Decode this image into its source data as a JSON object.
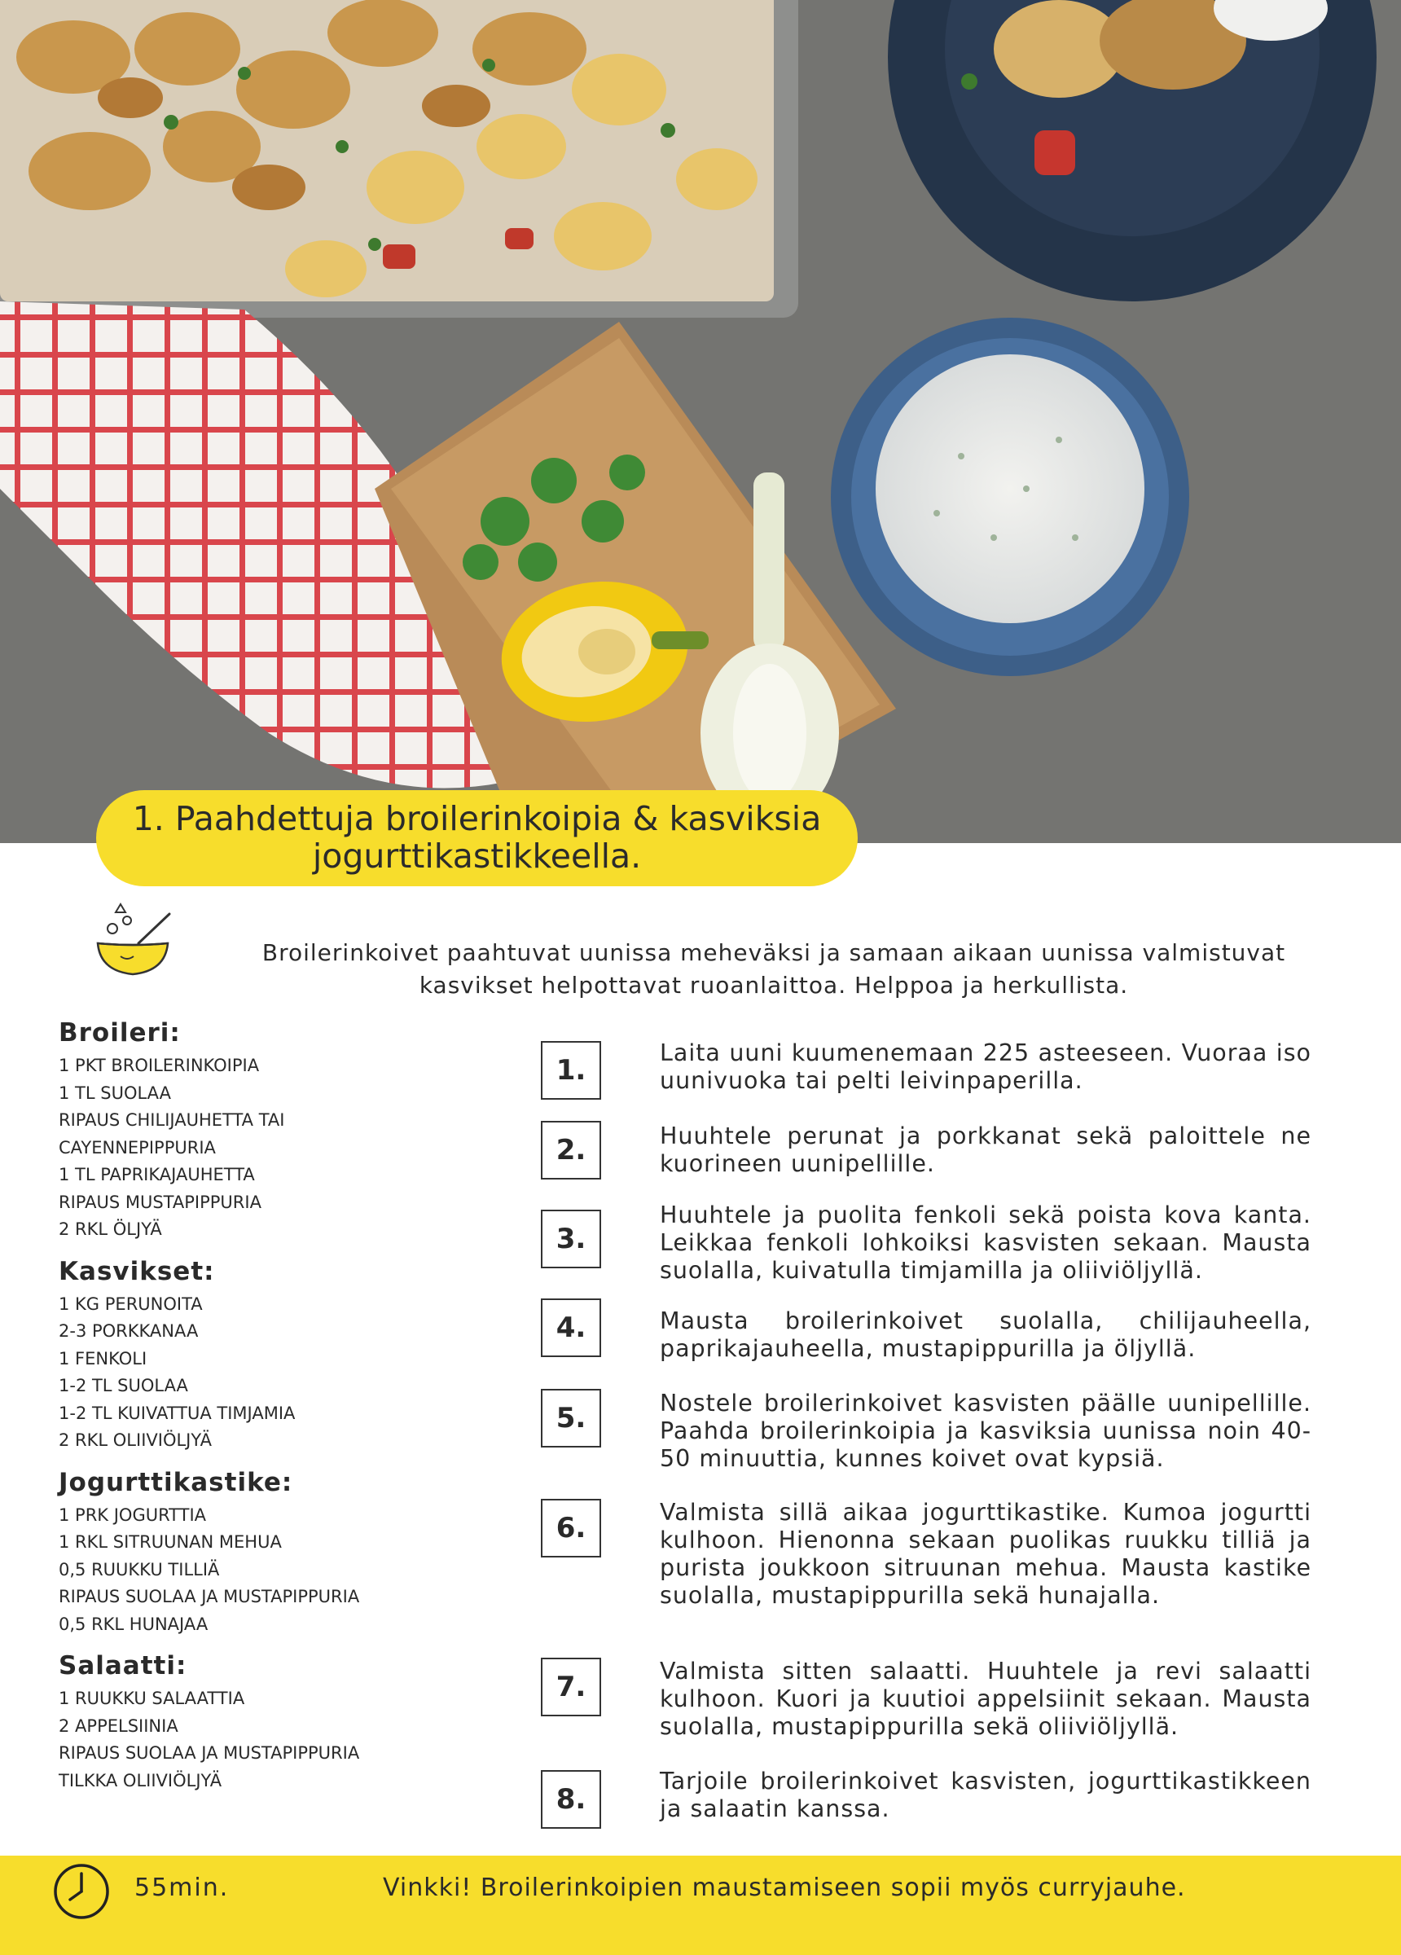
{
  "title": {
    "line1": "1. Paahdettuja broilerinkoipia & kasviksia",
    "line2": "jogurttikastikkeella."
  },
  "intro": "Broilerinkoivet paahtuvat uunissa meheväksi ja samaan aikaan uunissa valmistuvat kasvikset helpottavat ruoanlaittoa. Helppoa ja herkullista.",
  "ingredients": [
    {
      "heading": "Broileri:",
      "items": [
        "1 PKT BROILERINKOIPIA",
        "1 TL SUOLAA",
        "RIPAUS CHILIJAUHETTA TAI",
        "CAYENNEPIPPURIA",
        "1 TL PAPRIKAJAUHETTA",
        "RIPAUS MUSTAPIPPURIA",
        "2 RKL ÖLJYÄ"
      ]
    },
    {
      "heading": "Kasvikset:",
      "items": [
        "1 KG PERUNOITA",
        "2-3 PORKKANAA",
        "1 FENKOLI",
        "1-2 TL SUOLAA",
        "1-2 TL KUIVATTUA TIMJAMIA",
        "2 RKL OLIIVIÖLJYÄ"
      ]
    },
    {
      "heading": "Jogurttikastike:",
      "items": [
        "1 PRK JOGURTTIA",
        "1 RKL SITRUUNAN MEHUA",
        "0,5 RUUKKU TILLIÄ",
        "RIPAUS SUOLAA JA MUSTAPIPPURIA",
        "0,5 RKL HUNAJAA"
      ]
    },
    {
      "heading": "Salaatti:",
      "items": [
        "1 RUUKKU SALAATTIA",
        "2 APPELSIINIA",
        "RIPAUS SUOLAA JA MUSTAPIPPURIA",
        "TILKKA OLIIVIÖLJYÄ"
      ]
    }
  ],
  "steps": [
    {
      "num": "1.",
      "text": "Laita uuni kuumenemaan 225 asteeseen. Vuoraa iso uunivuoka tai pelti leivinpaperilla."
    },
    {
      "num": "2.",
      "text": "Huuhtele perunat ja porkkanat sekä paloittele ne kuorineen uunipellille."
    },
    {
      "num": "3.",
      "text": "Huuhtele ja puolita fenkoli sekä poista kova kanta. Leikkaa fenkoli lohkoiksi kasvisten sekaan. Mausta suolalla, kuivatulla timjamilla ja oliiviöljyllä."
    },
    {
      "num": "4.",
      "text": "Mausta broilerinkoivet suolalla, chilijauheella, paprikajauheella, mustapippurilla ja öljyllä."
    },
    {
      "num": "5.",
      "text": "Nostele broilerinkoivet kasvisten päälle uunipellille. Paahda broilerinkoipia ja kasviksia uunissa noin 40-50 minuuttia, kunnes koivet ovat kypsiä."
    },
    {
      "num": "6.",
      "text": "Valmista sillä aikaa jogurttikastike. Kumoa jogurtti kulhoon. Hienonna sekaan puolikas ruukku tilliä ja purista joukkoon sitruunan mehua. Mausta kastike suolalla, mustapippurilla sekä hunajalla."
    },
    {
      "num": "7.",
      "text": "Valmista sitten salaatti. Huuhtele ja revi salaatti kulhoon. Kuori ja kuutioi appelsiinit sekaan. Mausta suolalla, mustapippurilla sekä oliiviöljyllä."
    },
    {
      "num": "8.",
      "text": "Tarjoile broilerinkoivet kasvisten, jogurttikastikkeen ja salaatin kanssa."
    }
  ],
  "footer": {
    "time": "55min.",
    "tip": "Vinkki! Broilerinkoipien maustamiseen sopii myös curryjauhe."
  },
  "colors": {
    "accent_yellow": "#f7dd2c",
    "text": "#2a2a2a"
  },
  "icons": {
    "chef": "chef-mixing-bowl-icon",
    "clock": "clock-icon"
  }
}
